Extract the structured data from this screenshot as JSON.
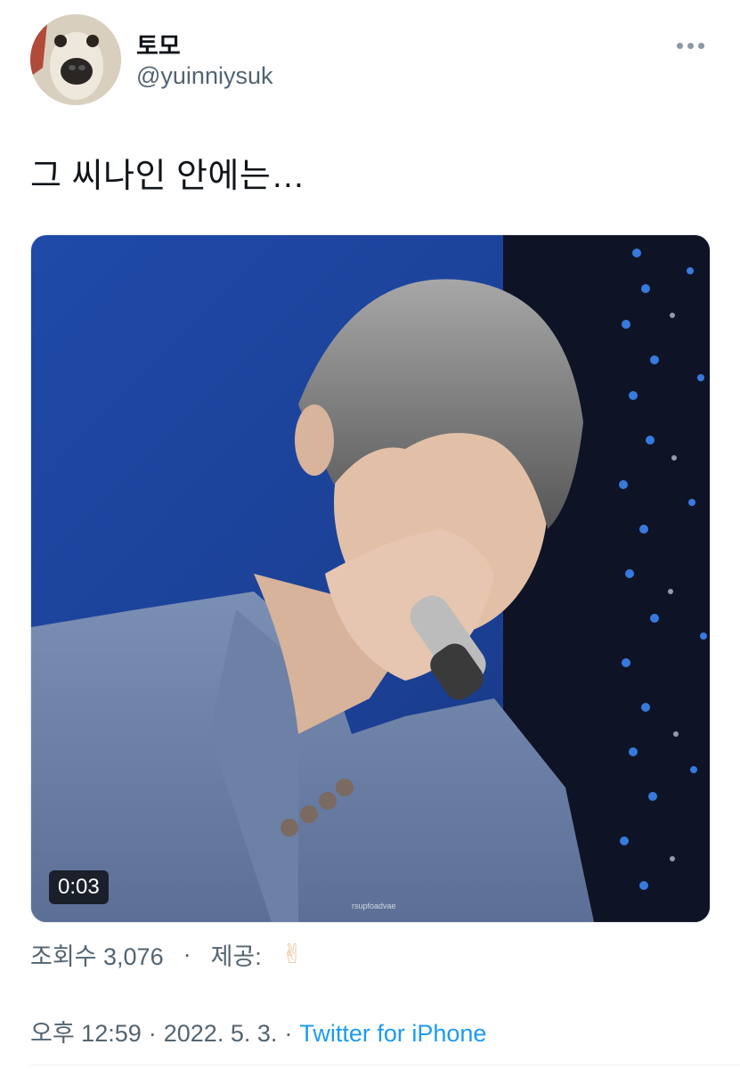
{
  "author": {
    "display_name": "토모",
    "handle": "@yuinniysuk"
  },
  "tweet": {
    "text": "그 씨나인 안에는…"
  },
  "media": {
    "duration": "0:03",
    "watermark": "rsupfoadvae"
  },
  "stats": {
    "views": "조회수 3,076",
    "dot": "·",
    "provided_by": "제공:",
    "provider_emoji": "✌"
  },
  "meta": {
    "time": "오후 12:59",
    "date": "2022. 5. 3.",
    "separator": "·",
    "source": "Twitter for iPhone"
  },
  "colors": {
    "accent": "#1d9bf0",
    "muted": "#536471"
  }
}
